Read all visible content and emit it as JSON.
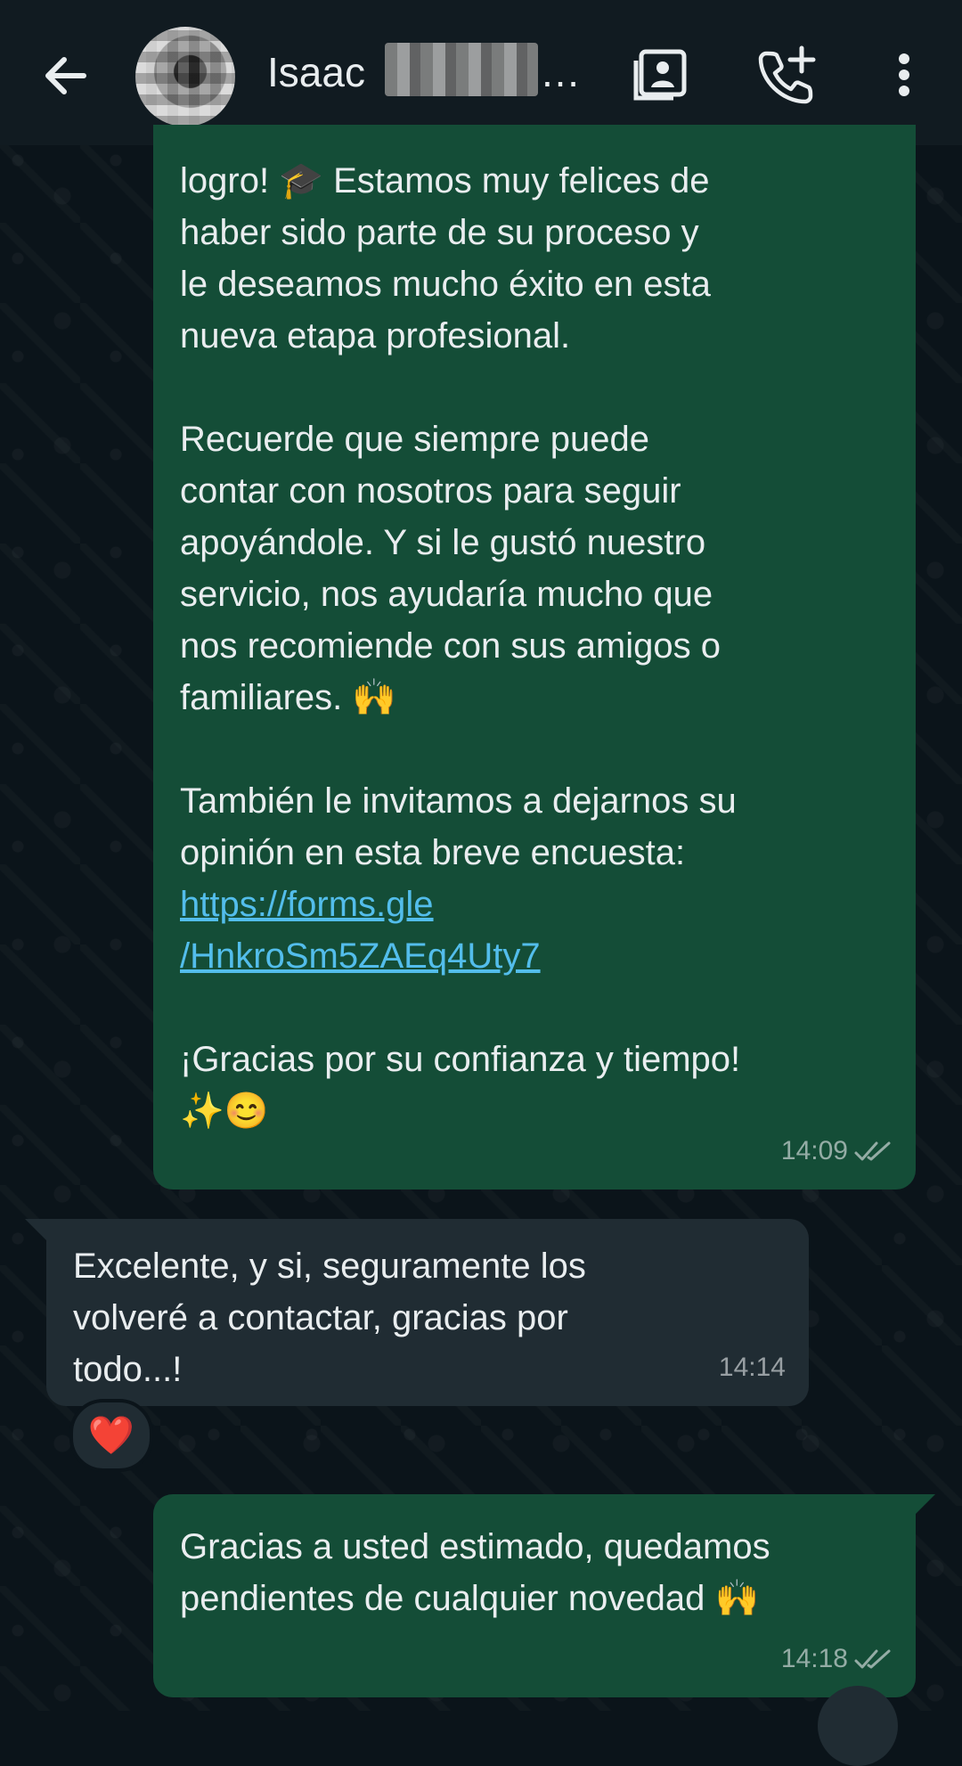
{
  "header": {
    "contact_name": "Isaac",
    "name_suffix": "…",
    "icons": [
      "back-arrow-icon",
      "contact-card-icon",
      "add-call-icon",
      "more-vert-icon"
    ]
  },
  "messages": [
    {
      "direction": "outgoing",
      "paragraphs": [
        "logro! 🎓 Estamos muy felices de\nhaber sido parte de su proceso y\nle deseamos mucho éxito en esta\nnueva etapa profesional.",
        "Recuerde que siempre puede\ncontar con nosotros para seguir\napoyándole. Y si le gustó nuestro\nservicio, nos ayudaría mucho que\nnos recomiende con sus amigos o\nfamiliares. 🙌",
        "También le invitamos a dejarnos su\nopinión en esta breve encuesta:"
      ],
      "link_line1": "https://forms.gle",
      "link_line2": "/HnkroSm5ZAEq4Uty7",
      "closing": "¡Gracias por su confianza y tiempo!\n✨😊",
      "time": "14:09",
      "status": "delivered"
    },
    {
      "direction": "incoming",
      "text": "Excelente, y si, seguramente los\nvolveré a contactar, gracias por\ntodo...!",
      "time": "14:14",
      "reaction": "❤️"
    },
    {
      "direction": "outgoing",
      "text": "Gracias a usted estimado, quedamos\npendientes de cualquier novedad 🙌",
      "time": "14:18",
      "status": "delivered"
    }
  ],
  "colors": {
    "header_bg": "#111b21",
    "chat_bg": "#0b141a",
    "outgoing_bubble": "#144d37",
    "incoming_bubble": "#202c33",
    "link": "#53bdeb"
  }
}
